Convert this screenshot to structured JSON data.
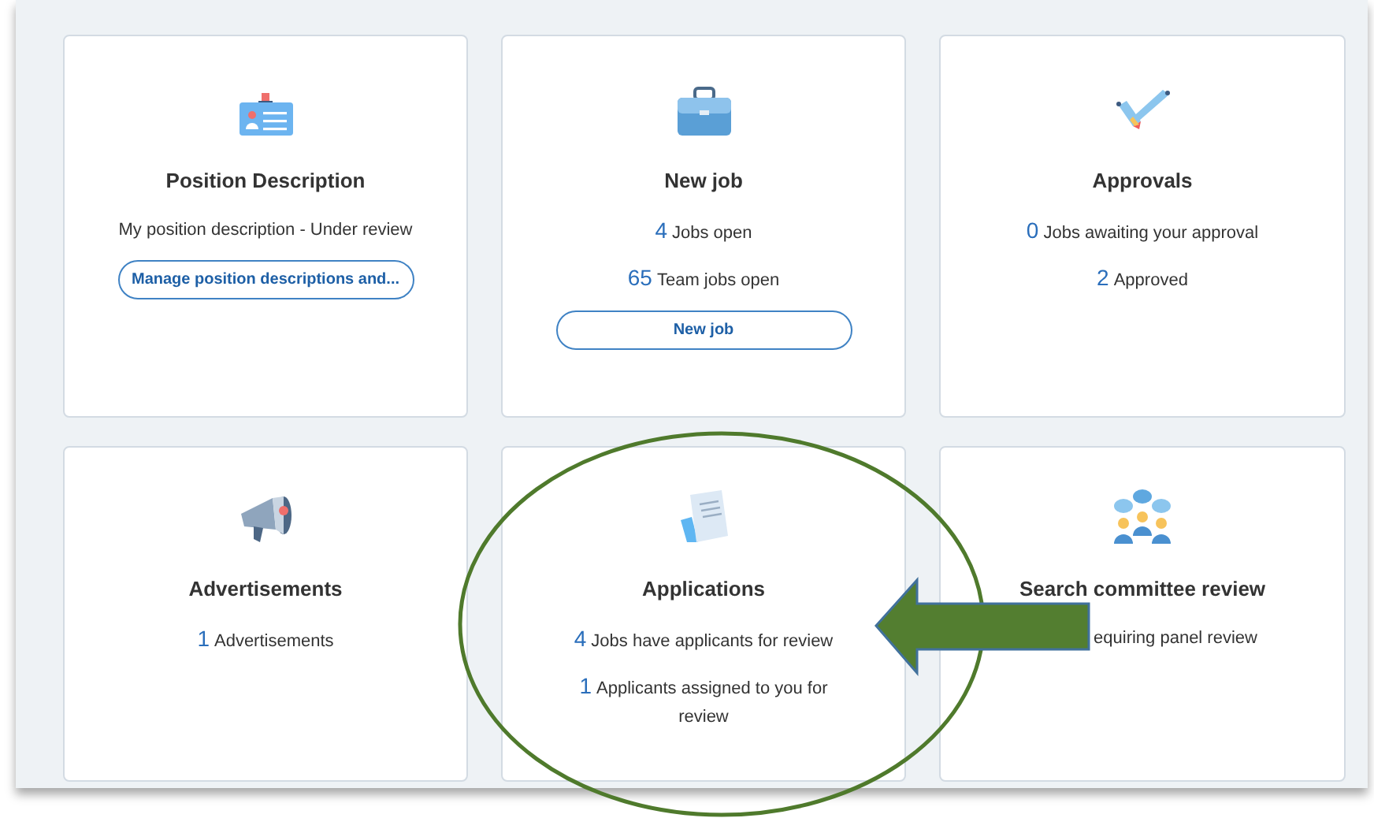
{
  "cards": [
    {
      "title": "Position Description",
      "lines": [
        {
          "text": "My position description - Under review"
        }
      ],
      "button": "Manage position descriptions and..."
    },
    {
      "title": "New job",
      "lines": [
        {
          "count": "4",
          "text": "Jobs open"
        },
        {
          "count": "65",
          "text": "Team jobs open"
        }
      ],
      "button": "New job"
    },
    {
      "title": "Approvals",
      "lines": [
        {
          "count": "0",
          "text": "Jobs awaiting your approval"
        },
        {
          "count": "2",
          "text": "Approved"
        }
      ]
    },
    {
      "title": "Advertisements",
      "lines": [
        {
          "count": "1",
          "text": "Advertisements"
        }
      ]
    },
    {
      "title": "Applications",
      "lines": [
        {
          "count": "4",
          "text": "Jobs have applicants for review"
        },
        {
          "count": "1",
          "text": "Applicants assigned to you for review"
        }
      ]
    },
    {
      "title": "Search committee review",
      "lines": [
        {
          "text": "equiring panel review",
          "kind": "partial"
        }
      ]
    }
  ]
}
